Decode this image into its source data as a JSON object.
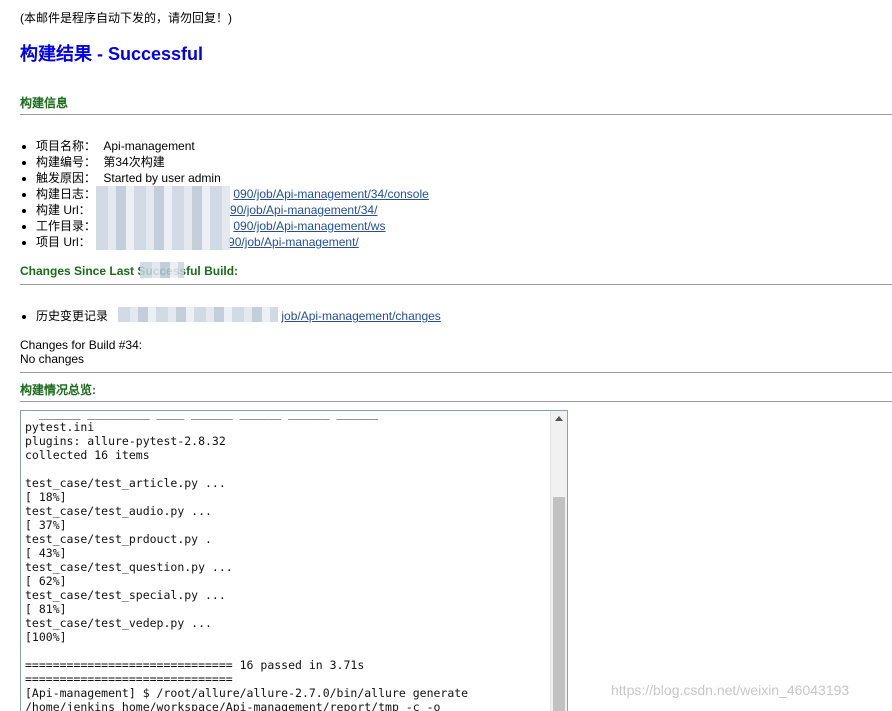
{
  "email": {
    "notice": "(本邮件是程序自动下发的，请勿回复！)",
    "title": "构建结果 - Successful"
  },
  "build_info": {
    "heading": "构建信息",
    "items": [
      {
        "label": "项目名称：",
        "value": "Api-management"
      },
      {
        "label": "构建编号：",
        "value": "第34次构建"
      },
      {
        "label": "触发原因：",
        "value": "Started by user admin"
      },
      {
        "label": "构建日志：",
        "link": "090/job/Api-management/34/console"
      },
      {
        "label": "构建 Url：",
        "link": "90/job/Api-management/34/"
      },
      {
        "label": "工作目录：",
        "link": "090/job/Api-management/ws"
      },
      {
        "label": "项目 Url：",
        "link": "90/job/Api-management/"
      }
    ]
  },
  "changes": {
    "heading": "Changes Since Last Successful Build:",
    "history_label": "历史变更记录",
    "history_link": "job/Api-management/changes",
    "for_build": "Changes for Build #34:",
    "none": "No changes"
  },
  "overview": {
    "heading": "构建情况总览:",
    "console_lines": [
      "pytest.ini",
      "plugins: allure-pytest-2.8.32",
      "collected 16 items",
      "",
      "test_case/test_article.py ...",
      "[ 18%]",
      "test_case/test_audio.py ...",
      "[ 37%]",
      "test_case/test_prdouct.py .",
      "[ 43%]",
      "test_case/test_question.py ...",
      "[ 62%]",
      "test_case/test_special.py ...",
      "[ 81%]",
      "test_case/test_vedep.py ...",
      "[100%]",
      "",
      "============================== 16 passed in 3.71s",
      "==============================",
      "[Api-management] $ /root/allure/allure-2.7.0/bin/allure generate",
      "/home/jenkins_home/workspace/Api-management/report/tmp -c -o"
    ]
  },
  "watermark": "https://blog.csdn.net/weixin_46043193"
}
